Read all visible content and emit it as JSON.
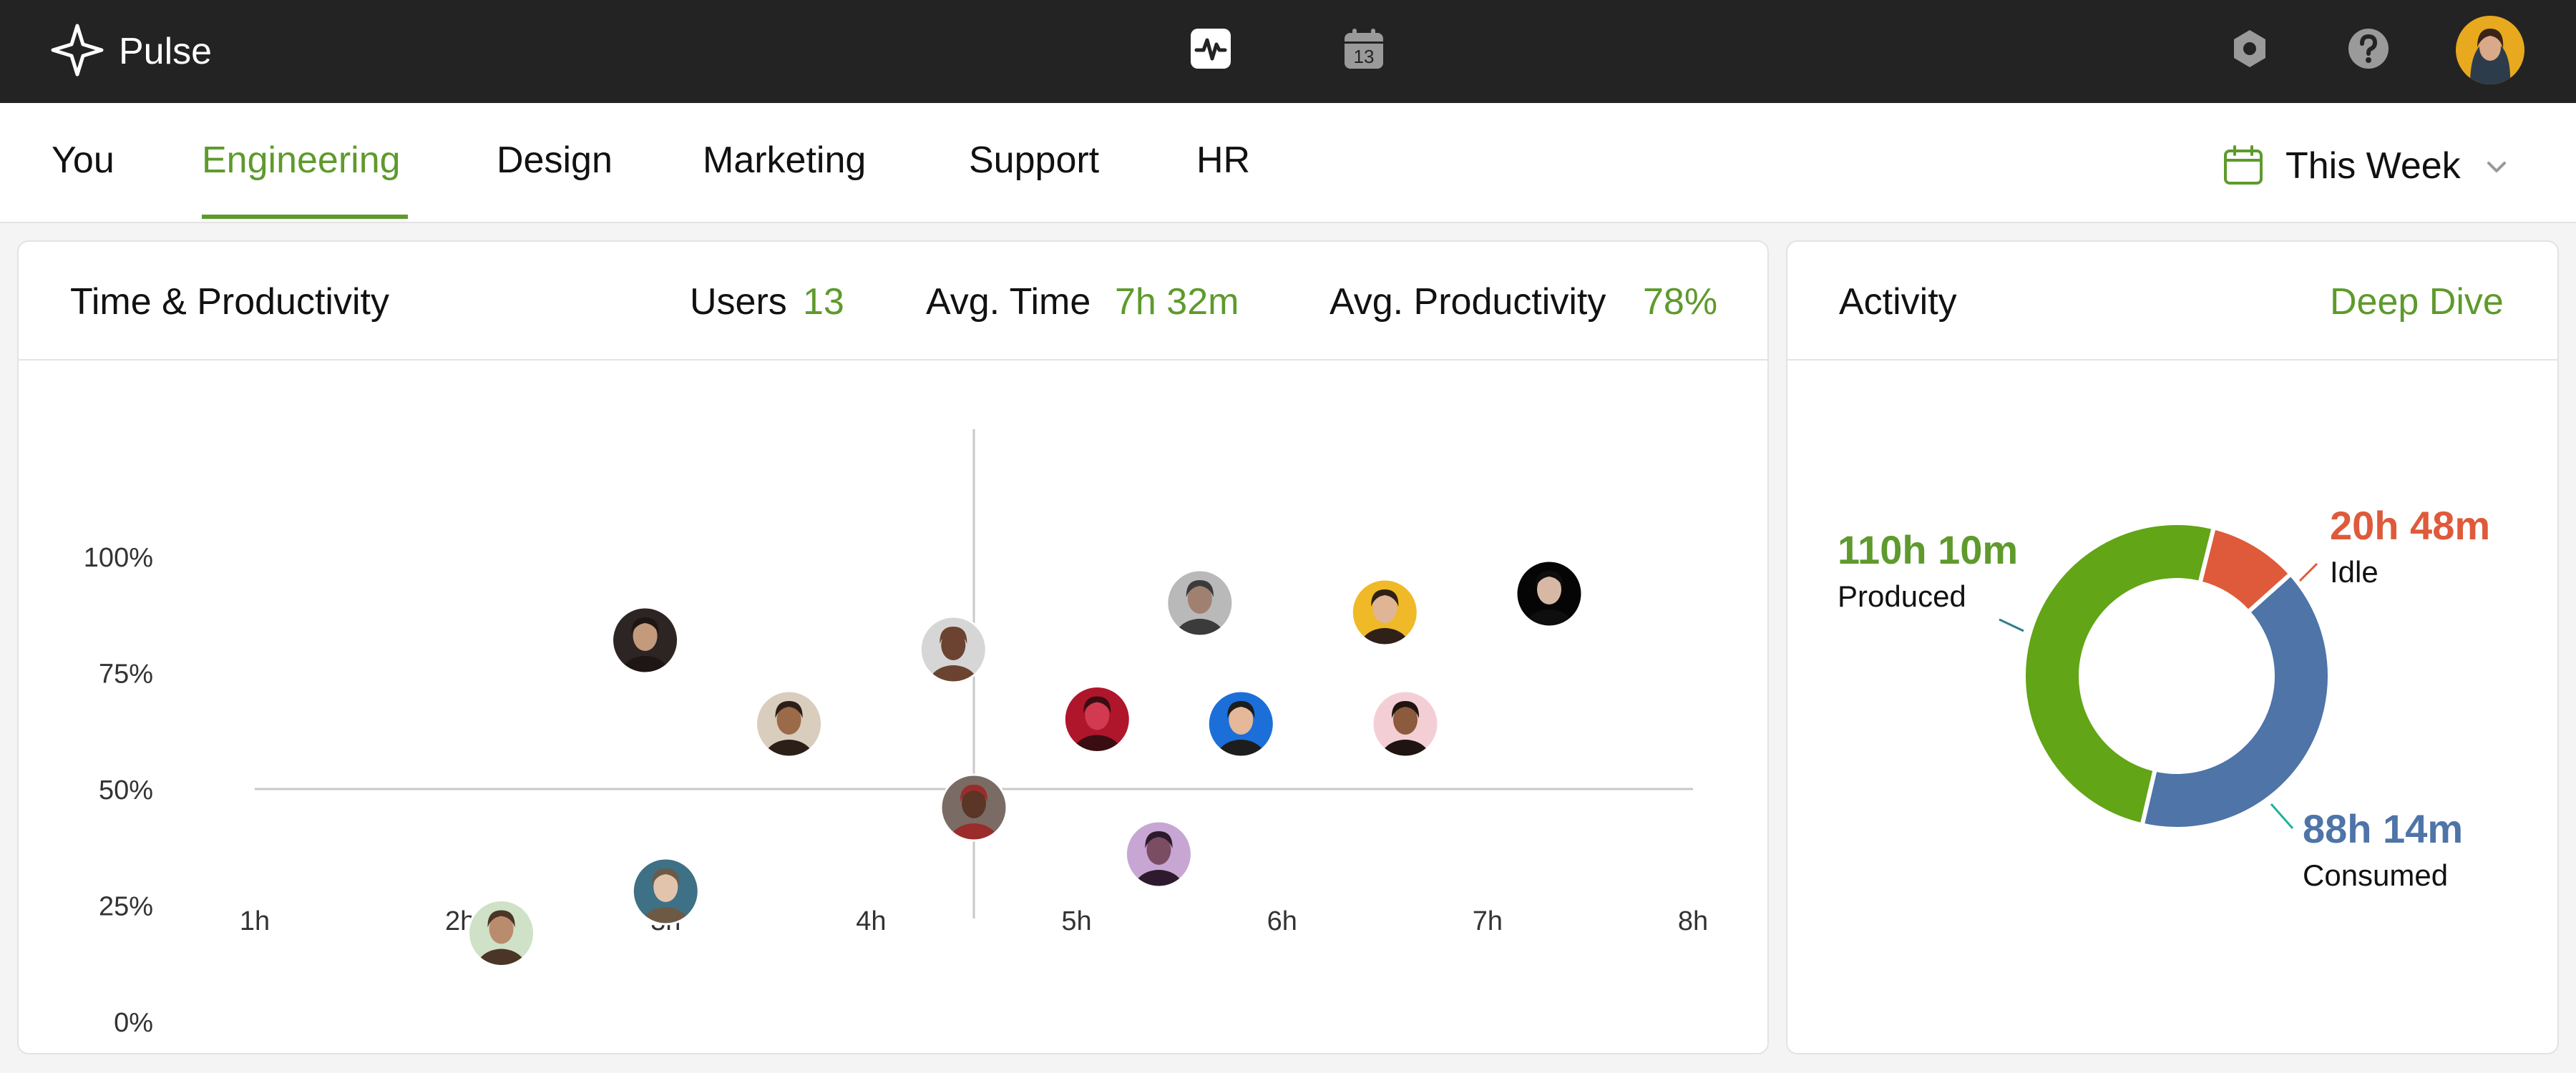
{
  "app": {
    "name": "Pulse"
  },
  "topbar": {
    "icons": [
      {
        "name": "activity-icon",
        "color": "#ffffff"
      },
      {
        "name": "calendar-13-icon",
        "label": "13",
        "color": "#9a9a9a"
      },
      {
        "name": "settings-icon",
        "color": "#9a9a9a"
      },
      {
        "name": "help-icon",
        "color": "#9a9a9a"
      }
    ]
  },
  "tabs": [
    {
      "label": "You",
      "active": false
    },
    {
      "label": "Engineering",
      "active": true
    },
    {
      "label": "Design",
      "active": false
    },
    {
      "label": "Marketing",
      "active": false
    },
    {
      "label": "Support",
      "active": false
    },
    {
      "label": "HR",
      "active": false
    }
  ],
  "date_filter": {
    "label": "This Week"
  },
  "productivity_card": {
    "title": "Time & Productivity",
    "stats": [
      {
        "label": "Users",
        "value": "13"
      },
      {
        "label": "Avg. Time",
        "value": "7h 32m"
      },
      {
        "label": "Avg. Productivity",
        "value": "78%"
      }
    ]
  },
  "activity_card": {
    "title": "Activity",
    "link": "Deep Dive"
  },
  "colors": {
    "accent": "#5e9a2c",
    "produced": "#62a516",
    "idle": "#df5a3a",
    "consumed": "#4e74a8",
    "produced_text": "#5e9a2c",
    "idle_text": "#df5a3a",
    "consumed_text": "#4e74a8"
  },
  "chart_data": [
    {
      "type": "scatter",
      "title": "",
      "xlabel": "",
      "ylabel": "",
      "xlim": [
        1,
        8
      ],
      "ylim": [
        0,
        100
      ],
      "x_ticks": [
        "1h",
        "2h",
        "3h",
        "4h",
        "5h",
        "6h",
        "7h",
        "8h"
      ],
      "y_ticks": [
        "0%",
        "25%",
        "50%",
        "75%",
        "100%"
      ],
      "reference_lines": {
        "x": 4.5,
        "y": 50
      },
      "grid": false,
      "points": [
        {
          "x": 2.2,
          "y": 19,
          "bg": "#cfe1c6",
          "skin": "#b98c6d",
          "hair": "#4a3526"
        },
        {
          "x": 2.9,
          "y": 82,
          "bg": "#2d2523",
          "skin": "#c49a7c",
          "hair": "#1e1614"
        },
        {
          "x": 3.0,
          "y": 28,
          "bg": "#3e7185",
          "skin": "#e2c4ac",
          "hair": "#6c5a47"
        },
        {
          "x": 3.6,
          "y": 64,
          "bg": "#d9cdbd",
          "skin": "#9b6a48",
          "hair": "#2b1f18"
        },
        {
          "x": 4.4,
          "y": 80,
          "bg": "#d6d6d6",
          "skin": "#6b4330",
          "hair": "#6b4330"
        },
        {
          "x": 4.5,
          "y": 46,
          "bg": "#7a6c65",
          "skin": "#5b3526",
          "hair": "#9b2c2c"
        },
        {
          "x": 5.1,
          "y": 65,
          "bg": "#b0162b",
          "skin": "#d23a52",
          "hair": "#3a0d12"
        },
        {
          "x": 5.4,
          "y": 36,
          "bg": "#c7a6d4",
          "skin": "#7a4d63",
          "hair": "#2d1b2d"
        },
        {
          "x": 5.6,
          "y": 90,
          "bg": "#b9b9b9",
          "skin": "#a08070",
          "hair": "#3b3b3b"
        },
        {
          "x": 5.8,
          "y": 64,
          "bg": "#1c6fd8",
          "skin": "#e4b898",
          "hair": "#1d1d1d"
        },
        {
          "x": 6.5,
          "y": 88,
          "bg": "#f0b928",
          "skin": "#e0b596",
          "hair": "#2f2118"
        },
        {
          "x": 6.6,
          "y": 64,
          "bg": "#f3cfd5",
          "skin": "#8c5a3c",
          "hair": "#1f1410"
        },
        {
          "x": 7.3,
          "y": 92,
          "bg": "#050505",
          "skin": "#d7b8a4",
          "hair": "#0e0e0e"
        }
      ]
    },
    {
      "type": "pie",
      "title": "",
      "slices": [
        {
          "label": "Produced",
          "value_text": "110h 10m",
          "value": 110.17
        },
        {
          "label": "Idle",
          "value_text": "20h 48m",
          "value": 20.8
        },
        {
          "label": "Consumed",
          "value_text": "88h 14m",
          "value": 88.23
        }
      ]
    }
  ]
}
